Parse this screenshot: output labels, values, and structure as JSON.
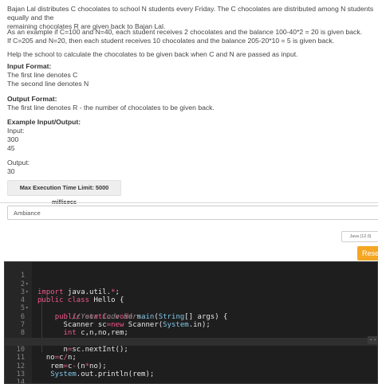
{
  "problem": {
    "para1_line1": "Bajan Lal distributes C chocolates to school N students every Friday. The C chocolates are distributed among N students equally and the",
    "para1_line2": "remaining chocolates R are given back to Bajan Lal.",
    "para2_line1": "As an example if C=100 and N=40, each student receives 2 chocolates and the balance 100-40*2 = 20 is given back.",
    "para2_line2": "If C=205 and N=20, then each student receives 10 chocolates and the balance 205-20*10 = 5 is given back.",
    "para3": "Help the school to calculate the chocolates to be given back when C and N are passed as input.",
    "input_format_heading": "Input Format:",
    "input_format_line1": "The first line denotes C",
    "input_format_line2": "The second line denotes N",
    "output_format_heading": "Output Format:",
    "output_format_line1": "The first line denotes R - the number of chocolates to be given back.",
    "example_heading": "Example Input/Output:",
    "input_label": "Input:",
    "input_values": [
      "300",
      "45"
    ],
    "output_label": "Output:",
    "output_value": "30"
  },
  "limit": {
    "label": "Max Execution Time Limit: 5000 millisecs"
  },
  "editor_settings": {
    "theme_value": "Ambiance",
    "language_value": "Java (12.0)",
    "reset_label": "Rese"
  },
  "colors": {
    "reset_button": "#f5a623",
    "editor_background": "#1e1e1e",
    "keyword": "#f0568a",
    "comment": "#8b8b8b"
  },
  "editor": {
    "line_numbers": [
      "1",
      "2",
      "3",
      "4",
      "5",
      "6",
      "7",
      "8",
      "9",
      "10",
      "11",
      "12",
      "13",
      "14",
      "15"
    ],
    "more_button_label": "..."
  }
}
